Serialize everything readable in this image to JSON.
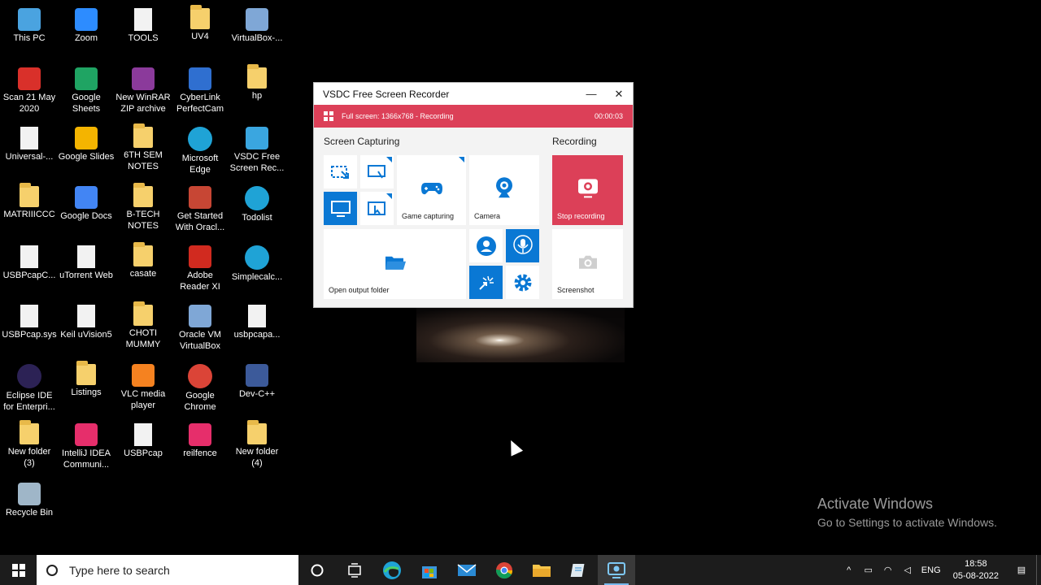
{
  "desktop": {
    "icons": [
      {
        "label": "This PC",
        "icon": "this-pc-icon"
      },
      {
        "label": "Zoom",
        "icon": "zoom-icon"
      },
      {
        "label": "TOOLS",
        "icon": "file-icon"
      },
      {
        "label": "UV4",
        "icon": "folder-icon"
      },
      {
        "label": "VirtualBox-...",
        "icon": "virtualbox-icon"
      },
      {
        "label": "Scan 21 May\n2020",
        "icon": "pdf-icon"
      },
      {
        "label": "Google\nSheets",
        "icon": "google-sheets-icon"
      },
      {
        "label": "New WinRAR\nZIP archive",
        "icon": "winrar-icon"
      },
      {
        "label": "CyberLink\nPerfectCam",
        "icon": "cyberlink-icon"
      },
      {
        "label": "hp",
        "icon": "folder-icon"
      },
      {
        "label": "Universal-...",
        "icon": "file-icon"
      },
      {
        "label": "Google Slides",
        "icon": "google-slides-icon"
      },
      {
        "label": "6TH SEM\nNOTES",
        "icon": "folder-icon"
      },
      {
        "label": "Microsoft\nEdge",
        "icon": "edge-icon"
      },
      {
        "label": "VSDC Free\nScreen Rec...",
        "icon": "vsdc-icon"
      },
      {
        "label": "MATRIIICCC",
        "icon": "folder-icon"
      },
      {
        "label": "Google Docs",
        "icon": "google-docs-icon"
      },
      {
        "label": "B-TECH\nNOTES",
        "icon": "folder-icon"
      },
      {
        "label": "Get Started\nWith Oracl...",
        "icon": "oracle-icon"
      },
      {
        "label": "Todolist",
        "icon": "edge-icon"
      },
      {
        "label": "USBPcapC...",
        "icon": "file-icon"
      },
      {
        "label": "uTorrent Web",
        "icon": "file-icon"
      },
      {
        "label": "casate",
        "icon": "folder-icon"
      },
      {
        "label": "Adobe\nReader XI",
        "icon": "adobe-reader-icon"
      },
      {
        "label": "Simplecalc...",
        "icon": "edge-icon"
      },
      {
        "label": "USBPcap.sys",
        "icon": "file-icon"
      },
      {
        "label": "Keil uVision5",
        "icon": "file-icon"
      },
      {
        "label": "CHOTI\nMUMMY",
        "icon": "folder-icon"
      },
      {
        "label": "Oracle VM\nVirtualBox",
        "icon": "virtualbox-icon"
      },
      {
        "label": "usbpcapa...",
        "icon": "file-icon"
      },
      {
        "label": "Eclipse IDE\nfor Enterpri...",
        "icon": "eclipse-icon"
      },
      {
        "label": "Listings",
        "icon": "folder-icon"
      },
      {
        "label": "VLC media\nplayer",
        "icon": "vlc-icon"
      },
      {
        "label": "Google\nChrome",
        "icon": "chrome-icon"
      },
      {
        "label": "Dev-C++",
        "icon": "devcpp-icon"
      },
      {
        "label": "New folder\n(3)",
        "icon": "folder-icon"
      },
      {
        "label": "IntelliJ IDEA\nCommuni...",
        "icon": "intellij-icon"
      },
      {
        "label": "USBPcap",
        "icon": "file-icon"
      },
      {
        "label": "reilfence",
        "icon": "intellij-icon"
      },
      {
        "label": "New folder\n(4)",
        "icon": "folder-icon"
      },
      {
        "label": "Recycle Bin",
        "icon": "recycle-bin-icon"
      }
    ],
    "watermark": {
      "title": "Activate Windows",
      "subtitle": "Go to Settings to activate Windows."
    }
  },
  "recorder": {
    "title": "VSDC Free Screen Recorder",
    "status_text": "Full screen: 1366x768 - Recording",
    "timer": "00:00:03",
    "section_capturing": "Screen Capturing",
    "section_recording": "Recording",
    "game_capturing": "Game capturing",
    "camera": "Camera",
    "open_output_folder": "Open output folder",
    "stop_recording": "Stop recording",
    "screenshot": "Screenshot",
    "colors": {
      "status_red": "#dc4058",
      "accent_blue": "#0a78d4"
    }
  },
  "taskbar": {
    "search_placeholder": "Type here to search",
    "language": "ENG",
    "time": "18:58",
    "date": "05-08-2022"
  }
}
